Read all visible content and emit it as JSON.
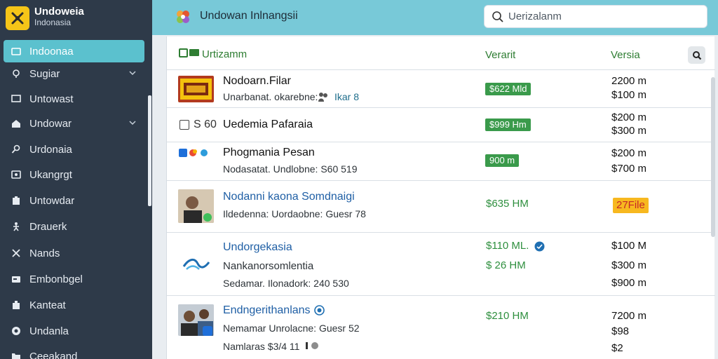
{
  "brand": {
    "name": "Undoweia",
    "subtitle": "Indonasia"
  },
  "sidebar": {
    "items": [
      {
        "label": "Indoonaa",
        "icon": "tag-icon",
        "active": true
      },
      {
        "label": "Sugiar",
        "icon": "location-icon",
        "expandable": true
      },
      {
        "label": "Untowast",
        "icon": "monitor-icon"
      },
      {
        "label": "Undowar",
        "icon": "home-icon",
        "expandable": true
      },
      {
        "label": "Urdonaia",
        "icon": "search-icon"
      },
      {
        "label": "Ukangrgt",
        "icon": "image-icon"
      },
      {
        "label": "Untowdar",
        "icon": "box-icon"
      },
      {
        "label": "Drauerk",
        "icon": "person-icon"
      },
      {
        "label": "Nands",
        "icon": "close-icon"
      },
      {
        "label": "Embonbgel",
        "icon": "card-icon"
      },
      {
        "label": "Kanteat",
        "icon": "building-icon"
      },
      {
        "label": "Undanla",
        "icon": "circle-icon"
      },
      {
        "label": "Ceeakand",
        "icon": "folder-icon"
      }
    ]
  },
  "header": {
    "title": "Undowan Inlnangsii",
    "search_placeholder": "Uerizalanm"
  },
  "table": {
    "columns": {
      "name": "Urtizamm",
      "variant": "Verarit",
      "version": "Versia"
    },
    "rows": [
      {
        "title": "Nodoarn.Filar",
        "subtitle": "Unarbanat. okarebne:",
        "extra": "Ikar 8",
        "variant_tag": "$622 Mld",
        "versions": [
          "2200 m",
          "$100 m"
        ]
      },
      {
        "title": "Uedemia Pafaraia",
        "lead": "S 60",
        "variant_tag": "$999 Hm",
        "versions": [
          "$200 m",
          "$300 m"
        ]
      },
      {
        "title": "Phogmania Pesan",
        "subtitle": "Nodasatat. Undlobne: S60 519",
        "variant_tag": "900 m",
        "versions": [
          "$200 m",
          "$700 m"
        ]
      },
      {
        "title": "Nodanni kaona Somdnaigi",
        "subtitle": "Ildedenna: Uordaobne: Guesr 78",
        "variant_price": "$635 HM",
        "badge": "27File"
      },
      {
        "title": "Undorgekasia",
        "line2": "Nankanorsomlentia",
        "line3": "Sedamar. Ilonadork: 240 530",
        "prices": [
          "$110 ML.",
          "$ 26 HM"
        ],
        "versions": [
          "$100 M",
          "$300 m",
          "$900 m"
        ]
      },
      {
        "title": "Endngerithanlans",
        "line2": "Nemamar Unrolacne: Guesr 52",
        "line3": "Namlaras $3/4 11",
        "prices": [
          "$210 HM"
        ],
        "versions": [
          "7200 m",
          "$98",
          "$2"
        ]
      }
    ]
  },
  "colors": {
    "sidebar_bg": "#2e3a49",
    "topbar_bg": "#78c9d8",
    "active_bg": "#5bc1ce",
    "green": "#2e7d32",
    "warn": "#f7b81f",
    "brand_logo": "#f5c518"
  }
}
